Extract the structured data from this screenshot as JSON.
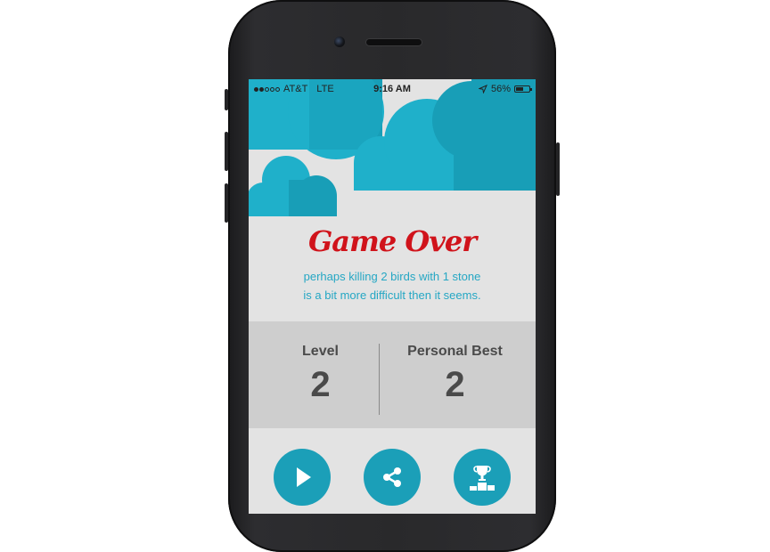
{
  "status_bar": {
    "carrier": "AT&T",
    "network": "LTE",
    "time": "9:16 AM",
    "battery": "56%",
    "battery_level": 0.56,
    "signal_bars": 2
  },
  "game_over": {
    "title": "Game Over",
    "message_line1": "perhaps killing 2 birds with 1 stone",
    "message_line2": "is a bit more difficult then it seems."
  },
  "scores": {
    "level_label": "Level",
    "level_value": "2",
    "best_label": "Personal Best",
    "best_value": "2"
  },
  "actions": {
    "play_icon": "play-icon",
    "share_icon": "share-icon",
    "leaderboard_icon": "trophy-podium-icon"
  },
  "colors": {
    "title": "#d0131b",
    "accent": "#1b9fb8",
    "cloud_light": "#1fb0ca",
    "cloud_dark": "#189eb7",
    "background": "#e3e3e3",
    "score_panel": "#cecece"
  }
}
